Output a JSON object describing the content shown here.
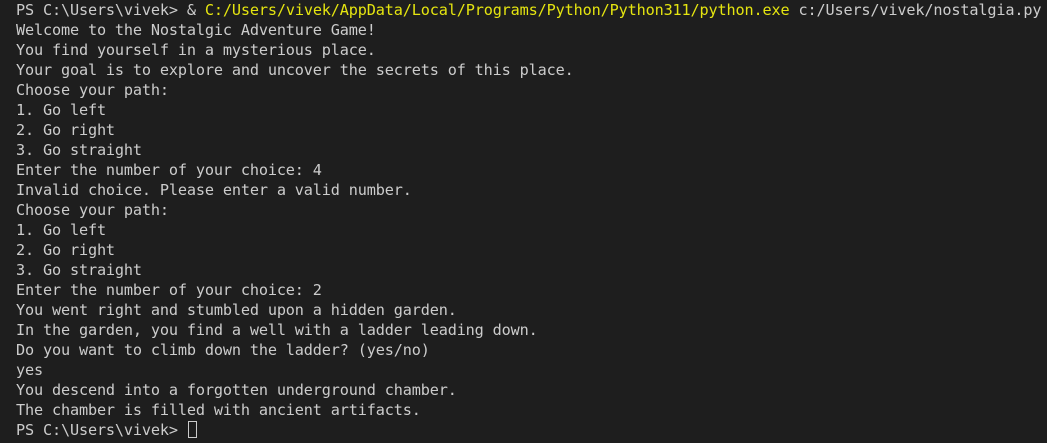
{
  "terminal": {
    "first_line": {
      "prompt": "PS C:\\Users\\vivek> ",
      "operator": "& ",
      "executable": "C:/Users/vivek/AppData/Local/Programs/Python/Python311/python.exe",
      "argument": " c:/Users/vivek/nostalgia.py"
    },
    "output_lines": [
      "Welcome to the Nostalgic Adventure Game!",
      "You find yourself in a mysterious place.",
      "Your goal is to explore and uncover the secrets of this place.",
      "Choose your path:",
      "1. Go left",
      "2. Go right",
      "3. Go straight",
      "Enter the number of your choice: 4",
      "Invalid choice. Please enter a valid number.",
      "Choose your path:",
      "1. Go left",
      "2. Go right",
      "3. Go straight",
      "Enter the number of your choice: 2",
      "You went right and stumbled upon a hidden garden.",
      "In the garden, you find a well with a ladder leading down.",
      "Do you want to climb down the ladder? (yes/no)",
      "yes",
      "You descend into a forgotten underground chamber.",
      "The chamber is filled with ancient artifacts."
    ],
    "last_prompt": "PS C:\\Users\\vivek> ",
    "colors": {
      "background": "#1e1e1e",
      "text": "#cccccc",
      "highlight": "#e5e510"
    }
  }
}
